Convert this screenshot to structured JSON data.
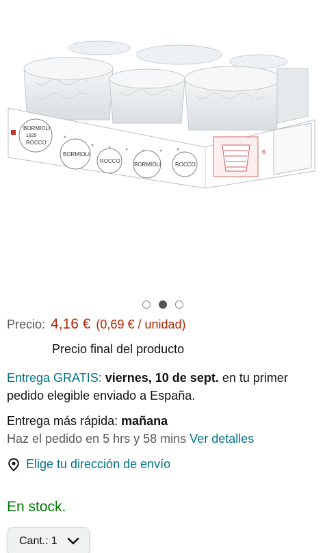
{
  "product_image": {
    "alt": "Bormioli Rocco glass set"
  },
  "carousel": {
    "count": 3,
    "active_index": 1
  },
  "price": {
    "label": "Precio:",
    "value": "4,16 €",
    "unit_price": "(0,69 € / unidad)",
    "final_note": "Precio final del producto",
    "color": "#B12704"
  },
  "delivery": {
    "free_label": "Entrega GRATIS:",
    "date": "viernes, 10 de sept.",
    "rest_line1": "en tu primer",
    "line2": "pedido elegible enviado a España."
  },
  "fast_delivery": {
    "label": "Entrega más rápida:",
    "day": "mañana",
    "order_within": "Haz el pedido en 5 hrs y 58 mins",
    "details_link": "Ver detalles"
  },
  "address": {
    "icon": "location-pin-icon",
    "label": "Elige tu dirección de envío"
  },
  "stock": {
    "label": "En stock.",
    "color": "#007600"
  },
  "quantity": {
    "label": "Cant.:",
    "value": "1"
  },
  "packaging": {
    "brand_line1": "BORMIOLI",
    "brand_line2": "ROCCO",
    "year": "1825",
    "count": "6"
  }
}
